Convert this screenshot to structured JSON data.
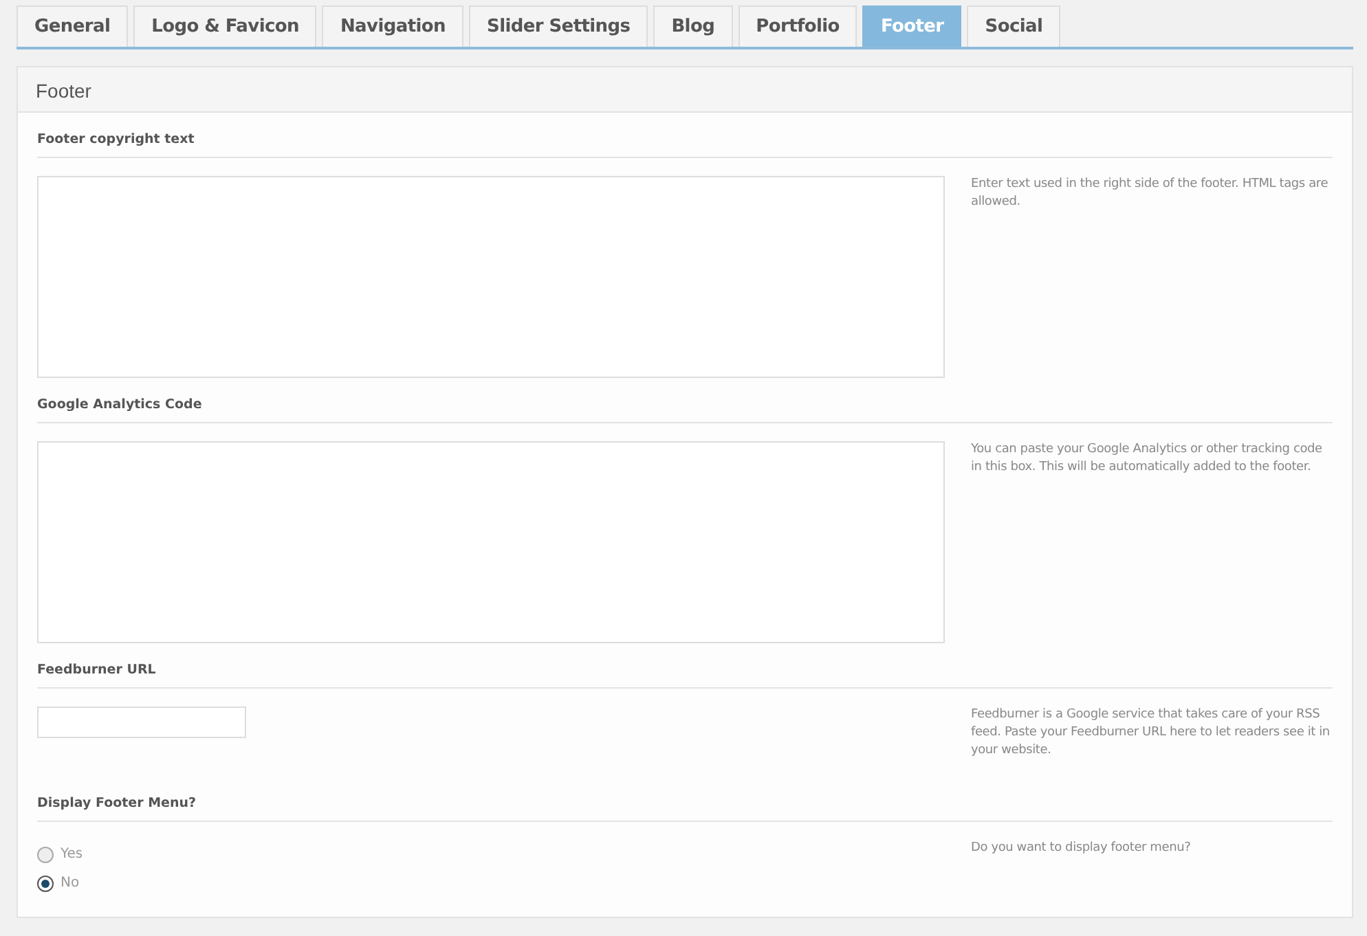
{
  "tabs": [
    {
      "label": "General",
      "selected": false
    },
    {
      "label": "Logo & Favicon",
      "selected": false
    },
    {
      "label": "Navigation",
      "selected": false
    },
    {
      "label": "Slider Settings",
      "selected": false
    },
    {
      "label": "Blog",
      "selected": false
    },
    {
      "label": "Portfolio",
      "selected": false
    },
    {
      "label": "Footer",
      "selected": true
    },
    {
      "label": "Social",
      "selected": false
    }
  ],
  "panel": {
    "title": "Footer"
  },
  "fields": [
    {
      "kind": "textarea",
      "label": "Footer copyright text",
      "description": "Enter text used in the right side of the footer. HTML tags are allowed."
    },
    {
      "kind": "textarea",
      "label": "Google Analytics Code",
      "description": "You can paste your Google Analytics or other tracking code in this box. This will be automatically added to the footer."
    },
    {
      "kind": "text",
      "label": "Feedburner URL",
      "description": "Feedburner is a Google service that takes care of your RSS feed. Paste your Feedburner URL here to let readers see it in your website."
    },
    {
      "kind": "radio",
      "label": "Display Footer Menu?",
      "description": "Do you want to display footer menu?",
      "options": [
        {
          "label": "Yes",
          "selected": false
        },
        {
          "label": "No",
          "selected": true
        }
      ]
    }
  ]
}
